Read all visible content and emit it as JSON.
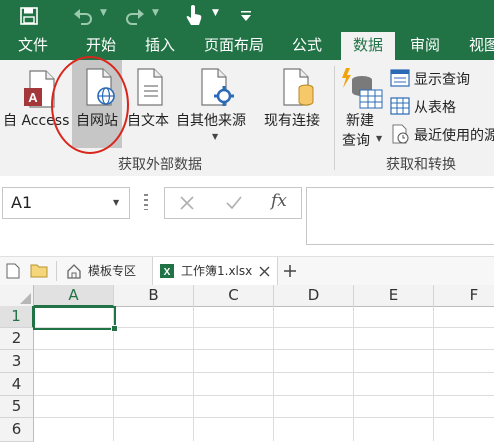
{
  "ribbon_tabs": [
    "文件",
    "开始",
    "插入",
    "页面布局",
    "公式",
    "数据",
    "审阅",
    "视图"
  ],
  "active_tab": "数据",
  "groups": {
    "external": {
      "label": "获取外部数据",
      "from_access": "自 Access",
      "from_web": "自网站",
      "from_text": "自文本",
      "from_other": "自其他来源",
      "existing": "现有连接"
    },
    "transform": {
      "label": "获取和转换",
      "new_query_line1": "新建",
      "new_query_line2": "查询",
      "show_queries": "显示查询",
      "from_table": "从表格",
      "recent_sources": "最近使用的源"
    }
  },
  "formula_bar": {
    "name_box": "A1",
    "fx": "fx",
    "formula": ""
  },
  "doc_tabs": {
    "templates": "模板专区",
    "workbook": "工作簿1.xlsx"
  },
  "grid": {
    "columns": [
      "A",
      "B",
      "C",
      "D",
      "E",
      "F"
    ],
    "rows": [
      "1",
      "2",
      "3",
      "4",
      "5",
      "6"
    ]
  },
  "colors": {
    "accent": "#217346",
    "highlight_ring": "#d9261c"
  }
}
